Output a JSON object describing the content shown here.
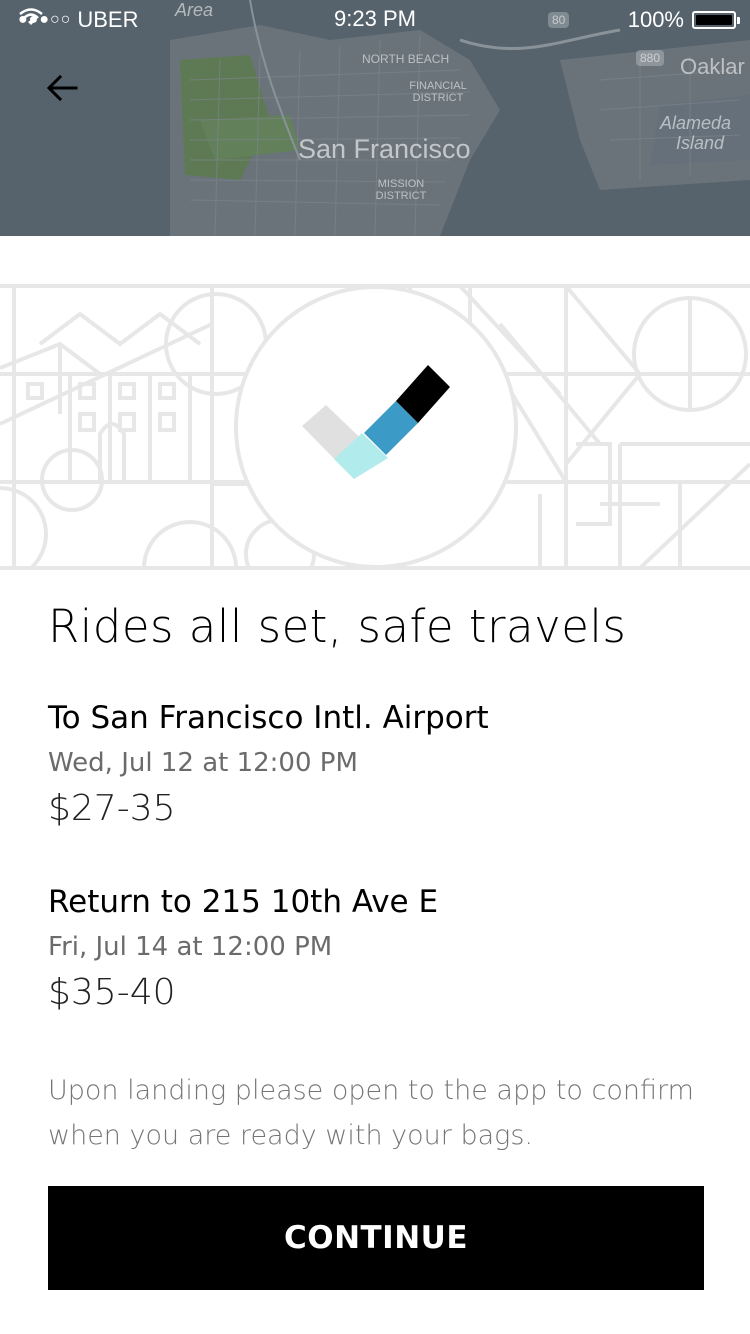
{
  "status_bar": {
    "signal": "●●●○○",
    "carrier": "UBER",
    "time": "9:23 PM",
    "battery": "100%"
  },
  "map": {
    "city_label": "San Francisco",
    "area_label": "Area",
    "north_beach": "NORTH BEACH",
    "financial_district": "FINANCIAL DISTRICT",
    "mission_district": "MISSION DISTRICT",
    "oakland": "Oaklar",
    "alameda": "Alameda",
    "island": "Island",
    "highway_80": "80",
    "highway_880": "880"
  },
  "header": {
    "back_icon": "arrow-left-icon"
  },
  "illustration": {
    "icon": "checkmark-icon",
    "colors": {
      "light_gray": "#e0e0e0",
      "light_cyan": "#b2ebec",
      "blue": "#3c9ac6",
      "black": "#000000"
    }
  },
  "headline": "Rides all set, safe travels",
  "trips": [
    {
      "title": "To San Francisco Intl. Airport",
      "date": "Wed, Jul 12 at 12:00 PM",
      "price": "$27-35"
    },
    {
      "title": "Return to 215 10th Ave E",
      "date": "Fri, Jul 14 at 12:00 PM",
      "price": "$35-40"
    }
  ],
  "note": "Upon landing please open to the app to confirm when you are ready with your bags.",
  "continue_label": "CONTINUE"
}
